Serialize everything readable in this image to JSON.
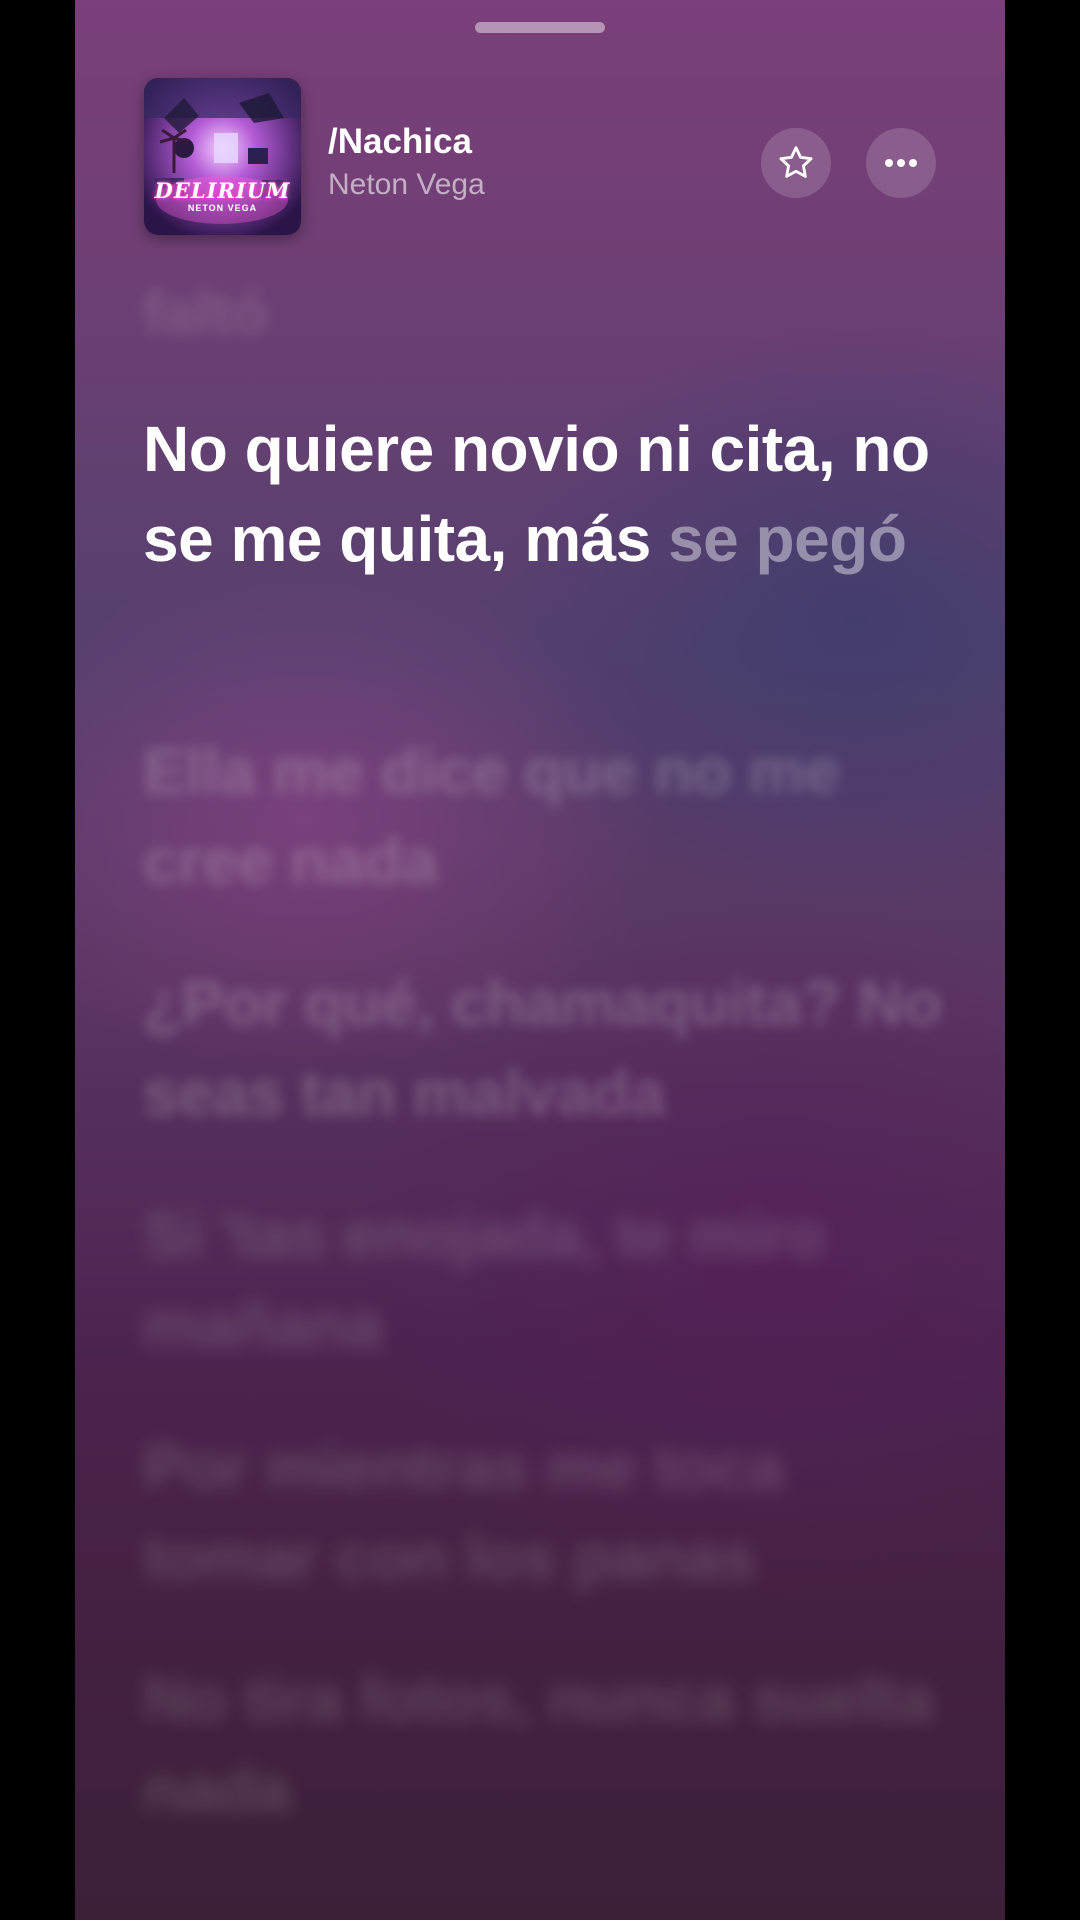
{
  "header": {
    "song_title": "/Nachica",
    "artist": "Neton Vega",
    "artwork": {
      "title": "DELIRIUM",
      "subtitle": "NETON VEGA"
    }
  },
  "controls": {
    "favorite_icon": "star-icon",
    "more_icon": "ellipsis-icon"
  },
  "lyrics": {
    "previous": "faltó",
    "current_sung": "No quiere novio ni cita, no se me quita, más",
    "current_pending": "se pegó",
    "next": [
      "Ella me dice que no me cree nada",
      "¿Por qué, chamaquita? No seas tan malvada",
      "Si 'tas enojada, te miro mañana",
      "Por mientras me toca tomar con los panas",
      "No tira fotos, nunca suelta nada"
    ]
  },
  "colors": {
    "background_top": "#7b3f7a",
    "background_bottom": "#3c2038",
    "highlight_text": "#ffffff"
  }
}
